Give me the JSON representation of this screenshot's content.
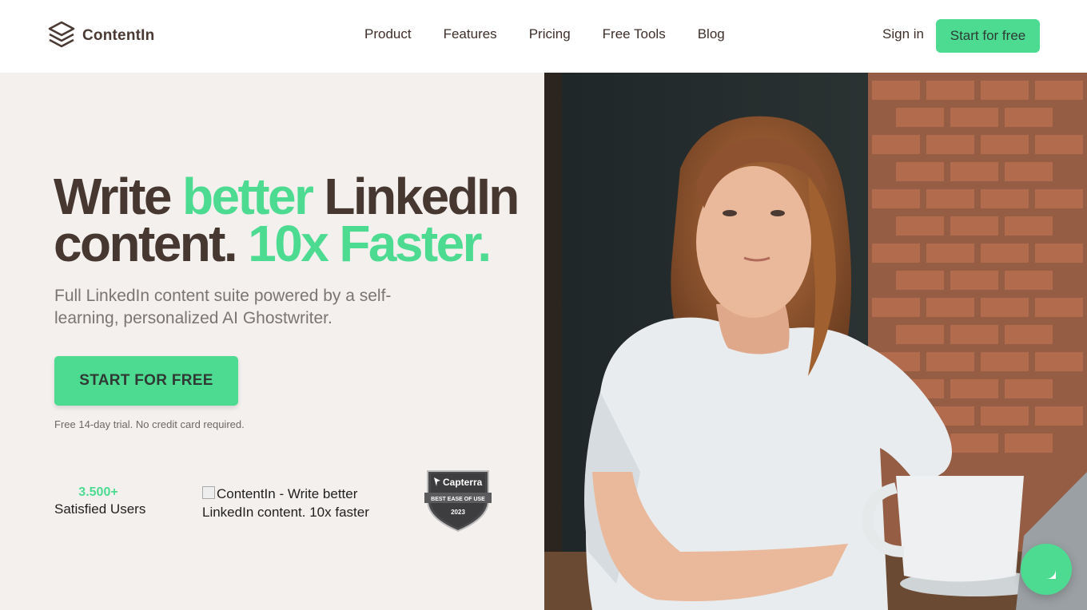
{
  "brand": {
    "name": "ContentIn"
  },
  "nav": {
    "items": [
      {
        "label": "Product"
      },
      {
        "label": "Features"
      },
      {
        "label": "Pricing"
      },
      {
        "label": "Free Tools"
      },
      {
        "label": "Blog"
      }
    ],
    "sign_in": "Sign in",
    "cta": "Start for free"
  },
  "hero": {
    "title_part1": "Write ",
    "title_part2": "better",
    "title_part3": " LinkedIn",
    "title_part4": "content. ",
    "title_part5": "10x Faster.",
    "subtitle": "Full LinkedIn content suite powered by a self-learning, personalized AI Ghostwriter.",
    "cta": "START FOR FREE",
    "note": "Free 14-day trial. No credit card required."
  },
  "stats": {
    "number": "3.500+",
    "label": "Satisfied Users"
  },
  "broken_image_alt": "ContentIn - Write better LinkedIn content. 10x faster",
  "capterra_badge": {
    "brand": "Capterra",
    "line1": "BEST EASE OF USE",
    "year": "2023"
  },
  "colors": {
    "accent": "#4ddb92",
    "text_dark": "#463731",
    "hero_bg": "#f4f0ee"
  },
  "icons": {
    "logo": "stacked-layers-icon",
    "chat": "chat-bubble-icon"
  }
}
